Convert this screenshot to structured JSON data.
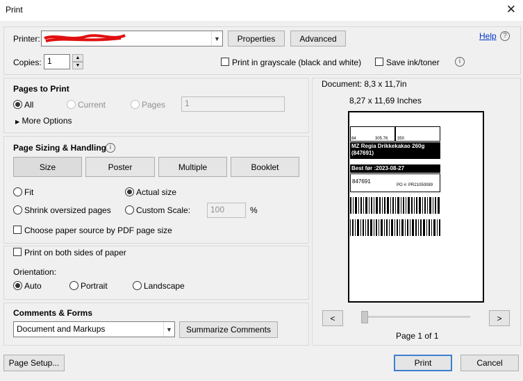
{
  "window": {
    "title": "Print",
    "close_glyph": "✕"
  },
  "printer": {
    "label": "Printer:",
    "properties_button": "Properties",
    "advanced_button": "Advanced",
    "help_link": "Help",
    "help_icon": "?",
    "copies_label": "Copies:",
    "copies_value": "1",
    "grayscale_label": "Print in grayscale (black and white)",
    "save_ink_label": "Save ink/toner",
    "info_icon": "i"
  },
  "pages_to_print": {
    "title": "Pages to Print",
    "all_label": "All",
    "current_label": "Current",
    "pages_label": "Pages",
    "pages_value": "1",
    "more_options": "More Options"
  },
  "sizing": {
    "title": "Page Sizing & Handling",
    "info_icon": "i",
    "tabs": [
      "Size",
      "Poster",
      "Multiple",
      "Booklet"
    ],
    "fit_label": "Fit",
    "actual_size_label": "Actual size",
    "shrink_label": "Shrink oversized pages",
    "custom_scale_label": "Custom Scale:",
    "custom_scale_value": "100",
    "percent": "%",
    "paper_source_label": "Choose paper source by PDF page size"
  },
  "duplex": {
    "both_sides_label": "Print on both sides of paper",
    "orientation_label": "Orientation:",
    "auto_label": "Auto",
    "portrait_label": "Portrait",
    "landscape_label": "Landscape"
  },
  "comments": {
    "title": "Comments & Forms",
    "selected": "Document and Markups",
    "summarize_button": "Summarize Comments"
  },
  "preview": {
    "document_size": "Document: 8,3 x 11,7in",
    "page_size": "8,27 x 11,69 Inches",
    "page_indicator": "Page 1 of 1",
    "prev": "<",
    "next": ">",
    "label_product": "MZ Regia Drikkekakao 260g (847691)",
    "label_best_before": "Best før :2023-08-27",
    "label_number": "847691",
    "label_po": "PO #: PR21050089",
    "label_small_1": "84",
    "label_small_2": "305.76",
    "label_small_3": "350"
  },
  "footer": {
    "page_setup": "Page Setup...",
    "print": "Print",
    "cancel": "Cancel"
  }
}
